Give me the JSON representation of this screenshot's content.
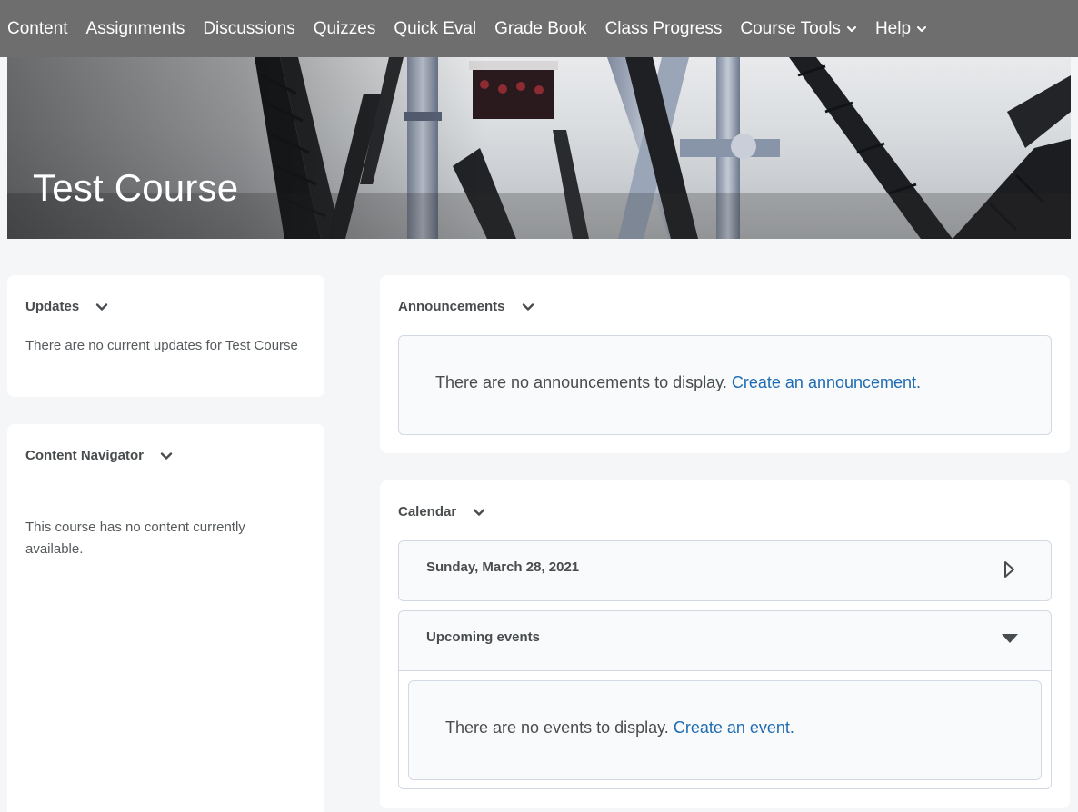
{
  "nav": {
    "items": [
      {
        "label": "Content"
      },
      {
        "label": "Assignments"
      },
      {
        "label": "Discussions"
      },
      {
        "label": "Quizzes"
      },
      {
        "label": "Quick Eval"
      },
      {
        "label": "Grade Book"
      },
      {
        "label": "Class Progress"
      }
    ],
    "course_tools": "Course Tools",
    "help": "Help"
  },
  "banner": {
    "title": "Test Course"
  },
  "updates": {
    "title": "Updates",
    "message": "There are no current updates for Test Course"
  },
  "content_navigator": {
    "title": "Content Navigator",
    "message": "This course has no content currently available."
  },
  "announcements": {
    "title": "Announcements",
    "message": "There are no announcements to display.",
    "link": "Create an announcement."
  },
  "calendar": {
    "title": "Calendar",
    "date": "Sunday, March 28, 2021",
    "upcoming_label": "Upcoming events",
    "message": "There are no events to display.",
    "link": "Create an event."
  },
  "colors": {
    "nav_bg": "#6e6e6e",
    "link": "#1e6bb0",
    "page_bg": "#f5f6f8"
  }
}
